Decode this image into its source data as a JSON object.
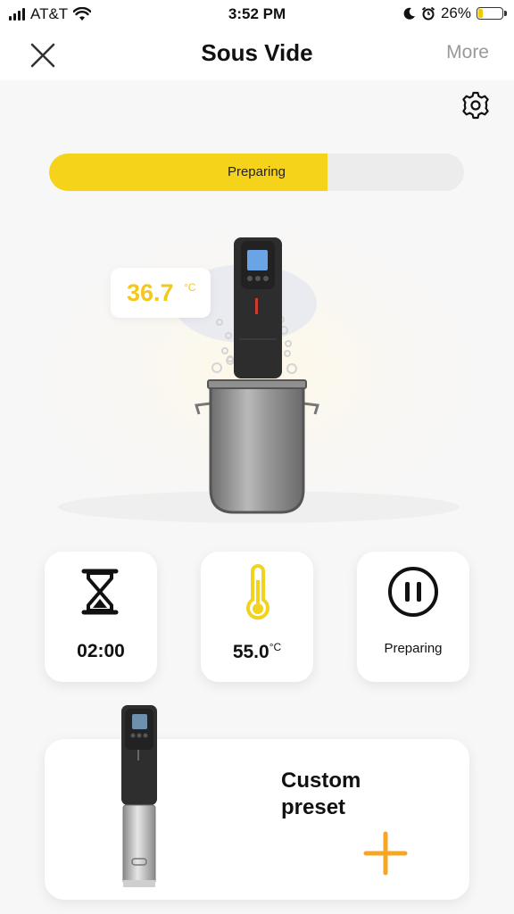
{
  "status_bar": {
    "carrier": "AT&T",
    "time": "3:52 PM",
    "battery_percent_label": "26%",
    "battery_level": 0.26,
    "icons": [
      "signal-icon",
      "wifi-icon",
      "moon-icon",
      "alarm-icon",
      "battery-icon"
    ]
  },
  "nav": {
    "title": "Sous Vide",
    "more_label": "More",
    "close_icon": "close-icon"
  },
  "settings_icon": "gear-icon",
  "progress": {
    "label": "Preparing",
    "fraction": 0.67,
    "fill_color": "#f5d31b"
  },
  "hero": {
    "current_temp": "36.7",
    "current_temp_unit": "°C"
  },
  "cards": {
    "timer": {
      "value": "02:00",
      "icon": "hourglass-icon"
    },
    "target_temp": {
      "value": "55.0",
      "unit": "°C",
      "icon": "thermometer-icon"
    },
    "state": {
      "label": "Preparing",
      "icon": "pause-icon"
    }
  },
  "preset": {
    "label_line1": "Custom",
    "label_line2": "preset",
    "add_icon": "plus-icon",
    "accent": "#f5a623"
  }
}
